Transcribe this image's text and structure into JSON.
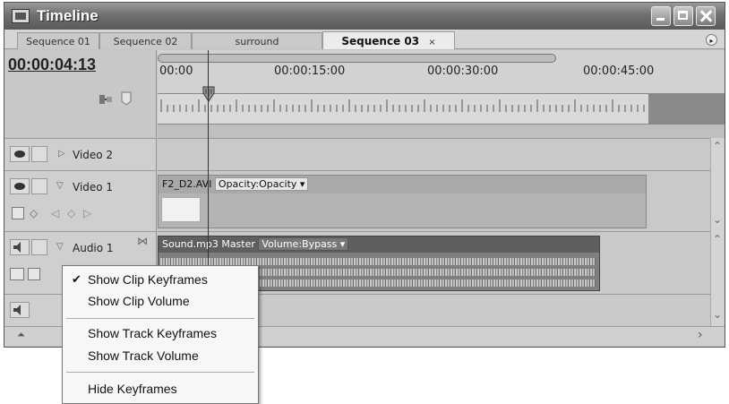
{
  "window": {
    "title": "Timeline",
    "icon": "timeline-app-icon"
  },
  "tabs": [
    {
      "label": "Sequence 01",
      "active": false
    },
    {
      "label": "Sequence 02",
      "active": false
    },
    {
      "label": "surround",
      "active": false
    },
    {
      "label": "Sequence 03",
      "active": true,
      "close": "×"
    }
  ],
  "timecode": "00:00:04:13",
  "ruler": {
    "labels": [
      "00:00",
      "00:00:15:00",
      "00:00:30:00",
      "00:00:45:00"
    ]
  },
  "tracks": {
    "video2": {
      "name": "Video 2",
      "expanded": false
    },
    "video1": {
      "name": "Video 1",
      "expanded": true,
      "clip": {
        "name": "F2_D2.AVI",
        "property": "Opacity:Opacity ▾"
      }
    },
    "audio1": {
      "name": "Audio 1",
      "expanded": true,
      "clip": {
        "name": "Sound.mp3 Master",
        "property": "Volume:Bypass ▾"
      }
    }
  },
  "context_menu": {
    "items": [
      {
        "label": "Show Clip Keyframes",
        "checked": true
      },
      {
        "label": "Show Clip Volume",
        "checked": false
      },
      {
        "label": "Show Track Keyframes",
        "checked": false
      },
      {
        "label": "Show Track Volume",
        "checked": false
      },
      {
        "label": "Hide Keyframes",
        "checked": false
      }
    ],
    "check_glyph": "✔"
  },
  "icons": {
    "panel_menu": "▸",
    "scroll_up": "⌃",
    "scroll_down": "⌄",
    "scroll_right": "›"
  }
}
